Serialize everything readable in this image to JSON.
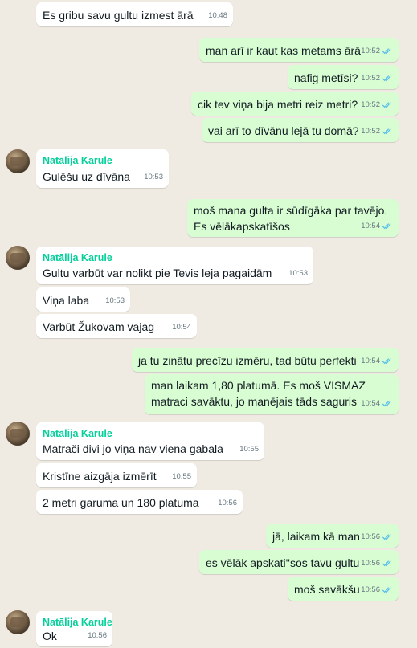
{
  "sender_name": "Natālija Karule",
  "messages": [
    {
      "dir": "in",
      "text": "Es gribu savu gultu izmest ārā",
      "time": "10:48"
    },
    {
      "dir": "out",
      "text": "man arī ir kaut kas metams ārā",
      "time": "10:52"
    },
    {
      "dir": "out",
      "text": "nafig metīsi?",
      "time": "10:52"
    },
    {
      "dir": "out",
      "text": "cik tev viņa bija metri reiz metri?",
      "time": "10:52"
    },
    {
      "dir": "out",
      "text": "vai arī to dīvānu lejā tu domā?",
      "time": "10:52"
    },
    {
      "dir": "in",
      "text": "Gulēšu uz dīvāna",
      "time": "10:53"
    },
    {
      "dir": "out",
      "text": "moš mana gulta ir sūdīgāka par tavējo. Es vēlākapskatīšos",
      "time": "10:54"
    },
    {
      "dir": "in",
      "text": "Gultu varbūt var nolikt pie Tevis leja pagaidām",
      "time": "10:53"
    },
    {
      "dir": "in",
      "text": "Viņa laba",
      "time": "10:53"
    },
    {
      "dir": "in",
      "text": "Varbūt Žukovam vajag",
      "time": "10:54"
    },
    {
      "dir": "out",
      "text": "ja tu zinātu precīzu izmēru, tad būtu perfekti",
      "time": "10:54"
    },
    {
      "dir": "out",
      "text": "man laikam 1,80 platumā. Es moš VISMAZ matraci savāktu, jo manējais tāds saguris",
      "time": "10:54"
    },
    {
      "dir": "in",
      "text": "Matrači divi jo viņa nav viena gabala",
      "time": "10:55"
    },
    {
      "dir": "in",
      "text": "Kristīne aizgāja izmērīt",
      "time": "10:55"
    },
    {
      "dir": "in",
      "text": "2 metri garuma un 180 platuma",
      "time": "10:56"
    },
    {
      "dir": "out",
      "text": "jā, laikam kā man",
      "time": "10:56"
    },
    {
      "dir": "out",
      "text": "es vēlāk apskati''sos tavu gultu",
      "time": "10:56"
    },
    {
      "dir": "out",
      "text": "moš savākšu",
      "time": "10:56"
    },
    {
      "dir": "in",
      "text": "Ok",
      "time": "10:56"
    }
  ],
  "colors": {
    "background": "#efeae2",
    "incoming": "#ffffff",
    "outgoing": "#d9fdd3",
    "sender": "#06cf9c",
    "read_ticks": "#53bdeb"
  }
}
